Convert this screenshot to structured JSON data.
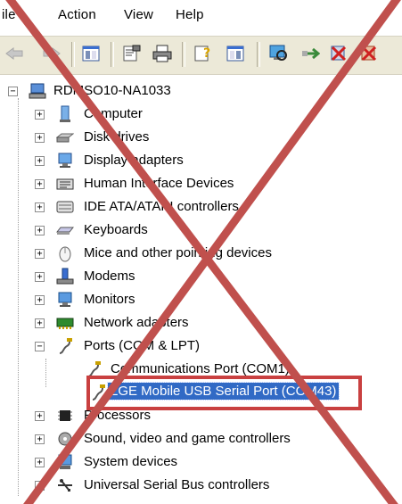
{
  "menu": {
    "file": "ile",
    "action": "Action",
    "view": "View",
    "help": "Help"
  },
  "toolbar": {
    "icons": [
      "back-icon",
      "forward-icon",
      "show-hide-tree-icon",
      "properties-icon",
      "print-icon",
      "help-icon",
      "show-hide-action-pane-icon",
      "scan-hardware-icon",
      "update-driver-icon",
      "disable-device-icon",
      "uninstall-device-icon"
    ]
  },
  "tree": {
    "root": "RDMSO10-NA1033",
    "items": [
      {
        "label": "Computer",
        "icon": "computer-icon"
      },
      {
        "label": "Disk drives",
        "icon": "disk-drive-icon"
      },
      {
        "label": "Display adapters",
        "icon": "display-adapter-icon"
      },
      {
        "label": "Human Interface Devices",
        "icon": "hid-icon"
      },
      {
        "label": "IDE ATA/ATAPI controllers",
        "icon": "ide-controller-icon"
      },
      {
        "label": "Keyboards",
        "icon": "keyboard-icon"
      },
      {
        "label": "Mice and other pointing devices",
        "icon": "mouse-icon"
      },
      {
        "label": "Modems",
        "icon": "modem-icon"
      },
      {
        "label": "Monitors",
        "icon": "monitor-icon"
      },
      {
        "label": "Network adapters",
        "icon": "network-adapter-icon"
      },
      {
        "label": "Ports (COM & LPT)",
        "icon": "port-icon"
      },
      {
        "label": "Processors",
        "icon": "processor-icon"
      },
      {
        "label": "Sound, video and game controllers",
        "icon": "sound-icon"
      },
      {
        "label": "System devices",
        "icon": "system-device-icon"
      },
      {
        "label": "Universal Serial Bus controllers",
        "icon": "usb-icon"
      }
    ],
    "ports_children": [
      {
        "label": "Communications Port (COM1)",
        "icon": "port-connector-icon"
      },
      {
        "label": "LGE Mobile USB Serial Port (COM43)",
        "icon": "port-connector-icon"
      }
    ]
  },
  "colors": {
    "selection": "#316ac5",
    "highlight_box": "#c94040",
    "cross": "#c0504d"
  }
}
